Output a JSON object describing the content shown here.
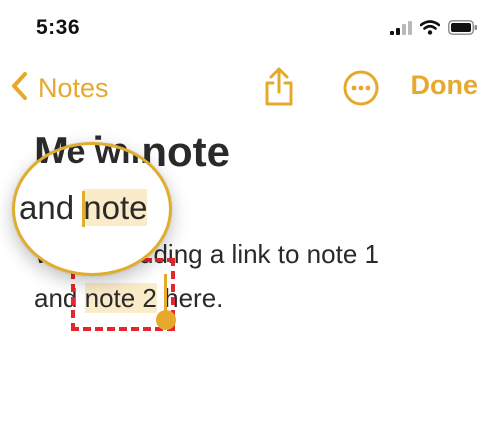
{
  "status_bar": {
    "time": "5:36",
    "icons": [
      "cellular-signal-icon",
      "wifi-icon",
      "battery-icon"
    ]
  },
  "nav": {
    "back_label": "Notes",
    "done_label": "Done",
    "icons": [
      "chevron-left-icon",
      "share-icon",
      "more-icon"
    ]
  },
  "note": {
    "title": "Main note",
    "line1": "We are adding a link to note 1",
    "line2_prefix": "and ",
    "line2_selected": "note 2",
    "line2_suffix": " here."
  },
  "magnifier": {
    "top_text": "We will",
    "prefix": "and ",
    "selected": "note"
  },
  "colors": {
    "accent": "#e6a92b",
    "highlight": "#fbecc9",
    "annotation": "#e4262f",
    "text": "#2a2a2a"
  }
}
